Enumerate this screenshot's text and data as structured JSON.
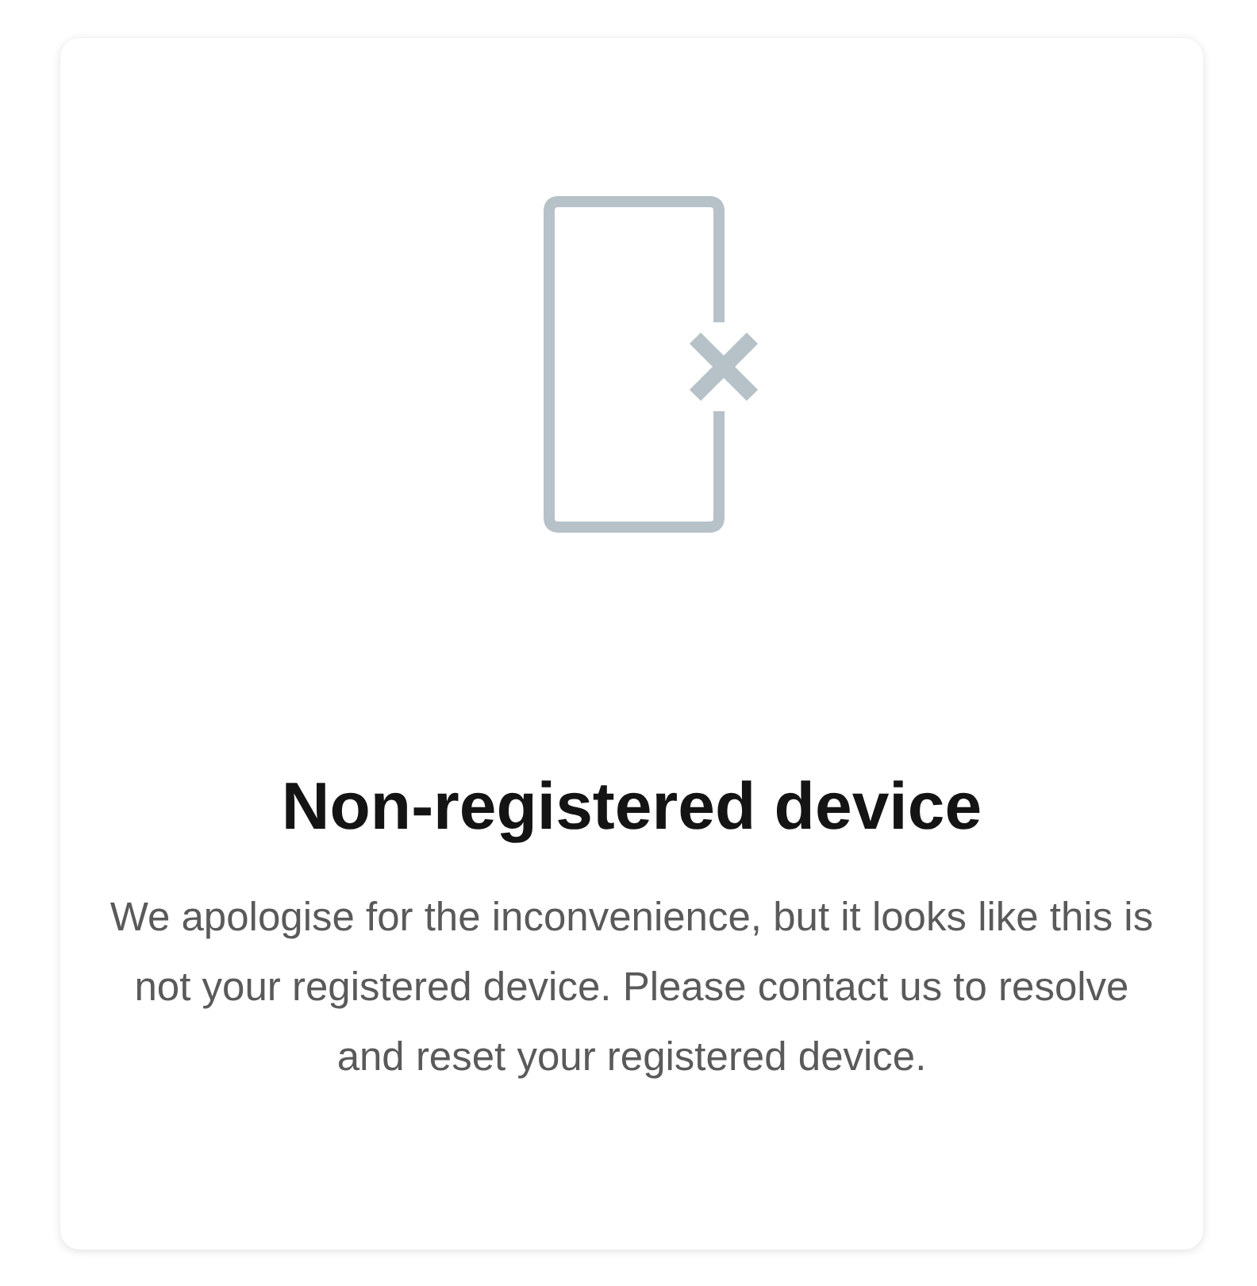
{
  "card": {
    "title": "Non-registered device",
    "message": "We apologise for the inconvenience, but it looks like this is not your registered device. Please contact us to resolve and reset your registered device."
  }
}
